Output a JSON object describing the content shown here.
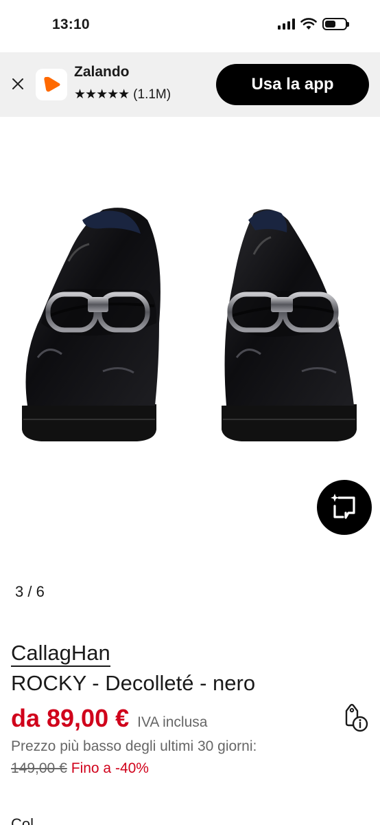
{
  "status_bar": {
    "time": "13:10"
  },
  "banner": {
    "app_name": "Zalando",
    "stars": "★★★★★",
    "rating_count": "(1.1M)",
    "open_app_label": "Usa la app",
    "brand_color": "#ff6900"
  },
  "gallery": {
    "counter": "3 / 6"
  },
  "product": {
    "brand": "CallagHan",
    "name": "ROCKY - Decolleté - nero",
    "price": "da 89,00 €",
    "vat_note": "IVA inclusa",
    "lowest_price_note": "Prezzo più basso degli ultimi 30 giorni:",
    "old_price": "149,00 €",
    "discount": "Fino a -40%",
    "next_section_label": "Col",
    "accent_color": "#d0021b"
  }
}
